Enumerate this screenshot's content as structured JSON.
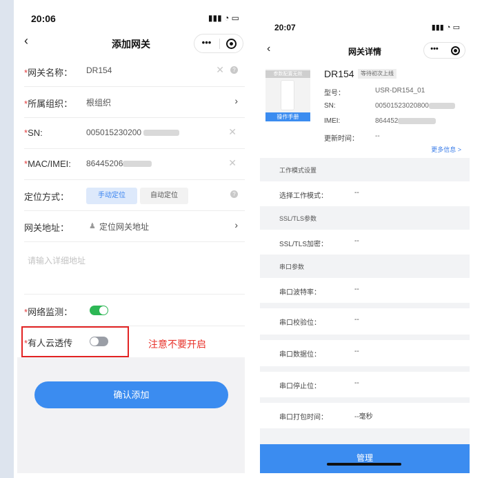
{
  "left": {
    "status_time": "20:06",
    "status_icons": "∷ ◒ ▬",
    "nav_title": "添加网关",
    "back": "‹",
    "capsule_more": "•••",
    "fields": {
      "name": {
        "label": "网关名称：",
        "value": "DR154"
      },
      "org": {
        "label": "所属组织：",
        "value": "根组织"
      },
      "sn": {
        "label": "SN:",
        "value": "005015230200"
      },
      "mac": {
        "label": "MAC/IMEI:",
        "value": "86445206"
      },
      "locate": {
        "label": "定位方式：",
        "manual": "手动定位",
        "auto": "自动定位"
      },
      "address": {
        "label": "网关地址：",
        "value": "定位网关地址"
      },
      "detail_placeholder": "请输入详细地址",
      "monitor": {
        "label": "网络监测：",
        "on": true
      },
      "cloud": {
        "label": "有人云透传",
        "on": false
      }
    },
    "required_mark": "*",
    "annotation": "注意不要开启",
    "confirm_label": "确认添加"
  },
  "right": {
    "status_time": "20:07",
    "nav_title": "网关详情",
    "back": "‹",
    "capsule_more": "•••",
    "device_tag": "参数配置无效",
    "device_manual": "操作手册",
    "device_name": "DR154",
    "device_status": "等待初次上线",
    "specs": [
      {
        "key": "型号：",
        "value": "USR-DR154_01"
      },
      {
        "key": "SN:",
        "value": "00501523020800"
      },
      {
        "key": "IMEI:",
        "value": "864452"
      },
      {
        "key": "更新时间：",
        "value": "--"
      }
    ],
    "more_info": "更多信息 >",
    "sections": [
      {
        "title": "工作模式设置",
        "items": [
          {
            "key": "选择工作模式：",
            "value": "--"
          }
        ]
      },
      {
        "title": "SSL/TLS参数",
        "items": [
          {
            "key": "SSL/TLS加密：",
            "value": "--"
          }
        ]
      },
      {
        "title": "串口参数",
        "items": [
          {
            "key": "串口波特率：",
            "value": "--"
          },
          {
            "key": "串口校验位：",
            "value": "--"
          },
          {
            "key": "串口数据位：",
            "value": "--"
          },
          {
            "key": "串口停止位：",
            "value": "--"
          },
          {
            "key": "串口打包时间：",
            "value": "--毫秒"
          }
        ]
      }
    ],
    "manage_label": "管理"
  }
}
